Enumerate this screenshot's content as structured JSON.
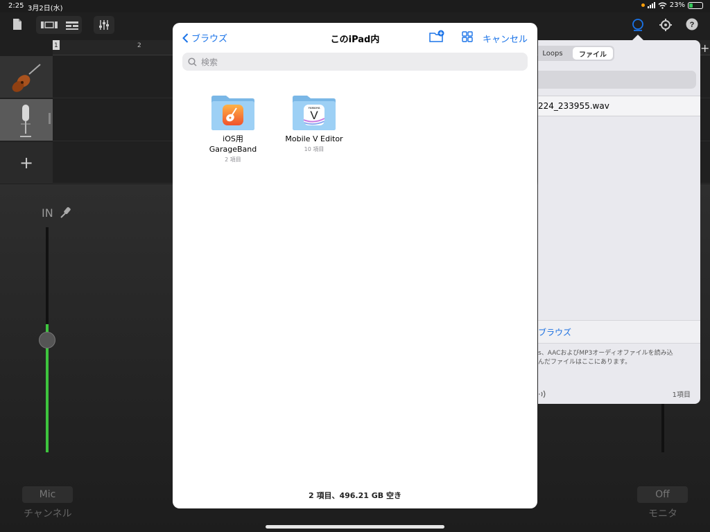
{
  "status_bar": {
    "time": "2:25",
    "date": "3月2日(水)",
    "battery": "23%"
  },
  "ruler": {
    "bar_1": "1",
    "bar_2": "2"
  },
  "mixer": {
    "input_label": "IN",
    "channel_button": "Mic",
    "channel_caption": "チャンネル",
    "monitor_button": "Off",
    "monitor_caption": "モニタ"
  },
  "add_track": "+",
  "loops_panel": {
    "tab_loops": "Loops",
    "tab_files": "ファイル",
    "file_name": "224_233955.wav",
    "browse_link": "ブラウズ",
    "info_line1": "s、AACおよびMP3オーディオファイルを読み込",
    "info_line2": "んだファイルはここにあります。",
    "item_count": "1項目"
  },
  "files_modal": {
    "back_label": "ブラウズ",
    "title": "このiPad内",
    "cancel_label": "キャンセル",
    "search_placeholder": "検索",
    "folders": [
      {
        "name_line1": "iOS用",
        "name_line2": "GarageBand",
        "count": "2 項目"
      },
      {
        "name_line1": "Mobile V Editor",
        "name_line2": "",
        "count": "10 項目"
      }
    ],
    "yamaha_badge": "YAMAHA",
    "yamaha_letter": "V",
    "footer_status": "2 項目、496.21 GB 空き"
  },
  "colors": {
    "accent_blue": "#1a73e8",
    "folder_blue": "#8fc8f2",
    "fader_green": "#3ec43e"
  }
}
